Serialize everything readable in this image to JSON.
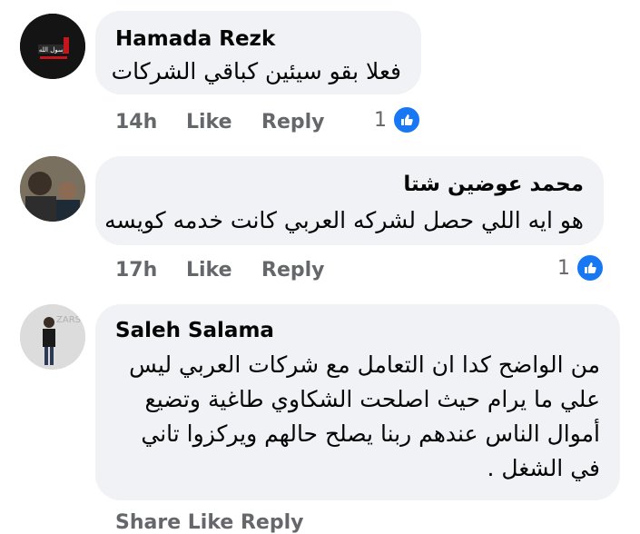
{
  "comments": [
    {
      "author": "Hamada Rezk",
      "text_lines": [
        "فعلا بقو سيئين كباقي الشركات"
      ],
      "time": "14h",
      "like_label": "Like",
      "reply_label": "Reply",
      "reaction_count": "1",
      "avatar_logo_text": "رسول الله"
    },
    {
      "author": "محمد عوضين شتا",
      "text_lines": [
        "هو ايه اللي حصل لشركه العربي كانت خدمه كويسه"
      ],
      "time": "17h",
      "like_label": "Like",
      "reply_label": "Reply",
      "reaction_count": "1"
    },
    {
      "author": "Saleh Salama",
      "text_lines": [
        "من الواضح كدا ان التعامل مع شركات العربي ليس",
        "علي ما يرام حيث اصلحت الشكاوي طاغية وتضيع",
        "أموال الناس عندهم ربنا يصلح حالهم ويركزوا تاني",
        "في الشغل ."
      ],
      "avatar_logo_text": "ZARS"
    }
  ],
  "partial_next_meta": "Share  Like  Reply",
  "colors": {
    "bubble": "#f0f2f5",
    "meta_text": "#65676b",
    "like_blue": "#1877f2"
  }
}
